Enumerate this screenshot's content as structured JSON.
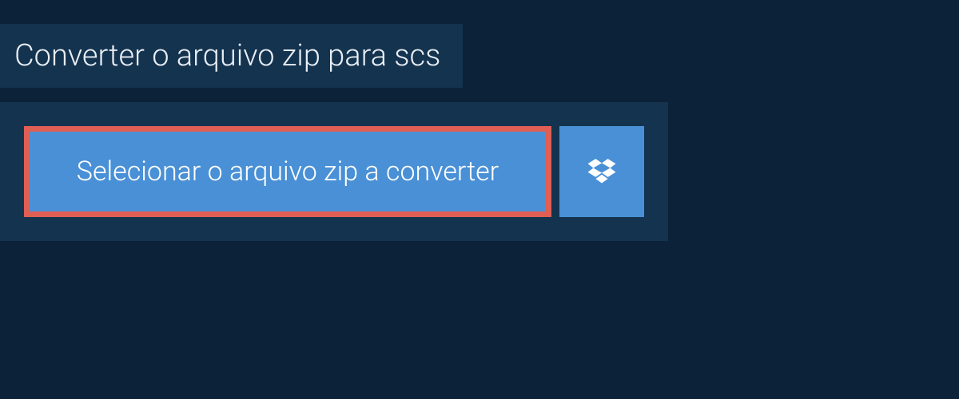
{
  "header": {
    "title": "Converter o arquivo zip para scs"
  },
  "main": {
    "select_button_label": "Selecionar o arquivo zip a converter"
  }
}
